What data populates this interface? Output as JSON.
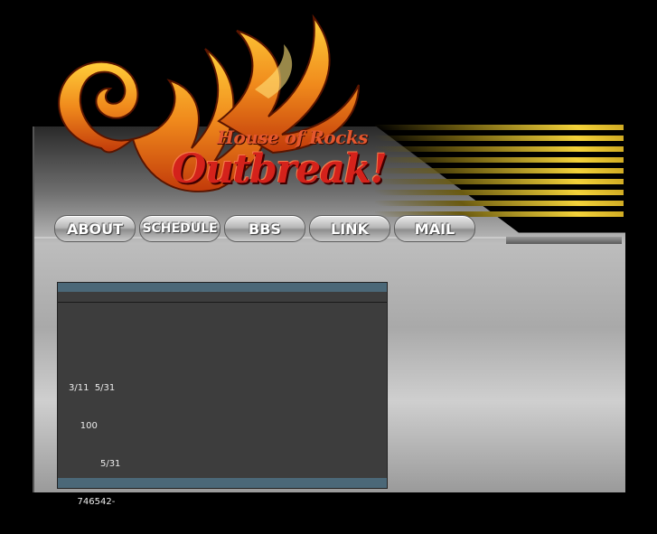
{
  "header": {
    "tagline": "House of Rocks",
    "brand": "Outbreak!"
  },
  "nav": {
    "items": [
      {
        "label": "ABOUT"
      },
      {
        "label": "SCHEDULE"
      },
      {
        "label": "BBS"
      },
      {
        "label": "LINK"
      },
      {
        "label": "MAIL"
      }
    ]
  },
  "content": {
    "lines": [
      "3/11  5/31",
      "    100",
      "           5/31",
      "   746542-"
    ]
  },
  "colors": {
    "flame": "#f08a1c",
    "brand_red": "#d4221b",
    "content_bg": "#3d3d3d",
    "bar_blue": "#4b6878",
    "stripe_gold": "#f3d23a"
  }
}
